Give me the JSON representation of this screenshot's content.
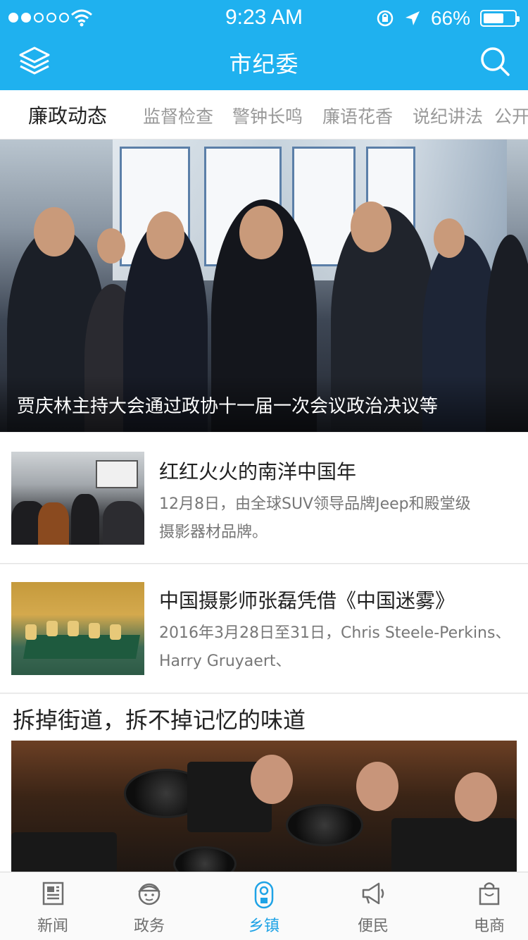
{
  "status_bar": {
    "time": "9:23 AM",
    "battery_percent": "66%",
    "battery_level": 0.66,
    "signal_bars": 2
  },
  "nav": {
    "title": "市纪委",
    "left_icon": "layers-icon",
    "right_icon": "search-icon"
  },
  "tabs": [
    {
      "label": "廉政动态",
      "active": true
    },
    {
      "label": "监督检查",
      "active": false
    },
    {
      "label": "警钟长鸣",
      "active": false
    },
    {
      "label": "廉语花香",
      "active": false
    },
    {
      "label": "说纪讲法",
      "active": false
    },
    {
      "label": "公开卄",
      "active": false
    }
  ],
  "hero": {
    "caption": "贾庆林主持大会通过政协十一届一次会议政治决议等"
  },
  "news": [
    {
      "title": "红红火火的南洋中国年",
      "desc_line1": "12月8日，由全球SUV领导品牌Jeep和殿堂级",
      "desc_line2": "摄影器材品牌。"
    },
    {
      "title": "中国摄影师张磊凭借《中国迷雾》",
      "desc_line1": "2016年3月28日至31日，Chris Steele-Perkins、",
      "desc_line2": "Harry Gruyaert、"
    }
  ],
  "feature": {
    "title": "拆掉街道，拆不掉记忆的味道"
  },
  "tabbar": [
    {
      "label": "新闻",
      "icon": "newspaper-icon",
      "active": false
    },
    {
      "label": "政务",
      "icon": "official-icon",
      "active": false
    },
    {
      "label": "乡镇",
      "icon": "location-pin-icon",
      "active": true
    },
    {
      "label": "便民",
      "icon": "megaphone-icon",
      "active": false
    },
    {
      "label": "电商",
      "icon": "shopping-bag-icon",
      "active": false
    }
  ],
  "colors": {
    "primary": "#1fb1ef",
    "tab_active": "#1fa3e6",
    "text_dark": "#222222",
    "text_muted": "#777777"
  }
}
